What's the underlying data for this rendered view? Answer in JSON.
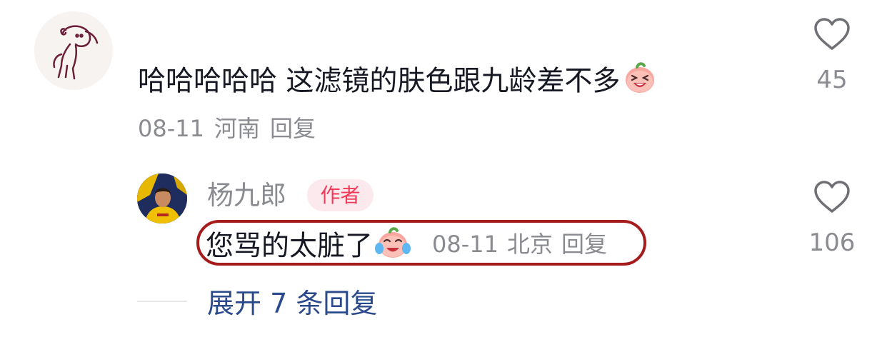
{
  "comment": {
    "text": "哈哈哈哈哈 这滤镜的肤色跟九龄差不多",
    "emoji": "laughing-peach-emoji",
    "date": "08-11",
    "location": "河南",
    "reply_label": "回复",
    "like_count": "45"
  },
  "reply": {
    "username": "杨九郎",
    "badge": "作者",
    "text": "您骂的太脏了",
    "emoji": "crying-laughing-peach-emoji",
    "date": "08-11",
    "location": "北京",
    "reply_label": "回复",
    "like_count": "106"
  },
  "expand_replies": "展开 7 条回复",
  "colors": {
    "text_primary": "#161823",
    "text_secondary": "#8a8b91",
    "badge_bg": "#fce9ed",
    "badge_text": "#f03a5a",
    "link": "#2b4a8c",
    "highlight": "#a61c1c"
  },
  "icons": {
    "like": "heart-outline-icon"
  }
}
